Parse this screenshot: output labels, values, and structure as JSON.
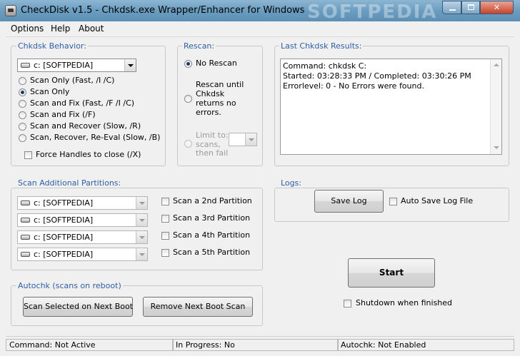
{
  "window": {
    "title": "CheckDisk   v1.5  -  Chkdsk.exe Wrapper/Enhancer for Windows",
    "watermark": "SOFTPEDIA"
  },
  "menu": [
    "Options",
    "Help",
    "About"
  ],
  "chkdsk_behavior": {
    "legend": "Chkdsk Behavior:",
    "drive": "c: [SOFTPEDIA]",
    "options": [
      {
        "label": "Scan Only (Fast, /I /C)",
        "selected": false
      },
      {
        "label": "Scan Only",
        "selected": true
      },
      {
        "label": "Scan and Fix (Fast, /F /I /C)",
        "selected": false
      },
      {
        "label": "Scan and Fix (/F)",
        "selected": false
      },
      {
        "label": "Scan and Recover (Slow, /R)",
        "selected": false
      },
      {
        "label": "Scan, Recover, Re-Eval (Slow, /B)",
        "selected": false
      }
    ],
    "force_handles": "Force Handles to close (/X)"
  },
  "rescan": {
    "legend": "Rescan:",
    "no_rescan": "No Rescan",
    "rescan_until": [
      "Rescan until",
      "Chkdsk",
      "returns no",
      "errors."
    ],
    "limit_to": [
      "Limit to:",
      "scans,",
      "then fail"
    ]
  },
  "results": {
    "legend": "Last Chkdsk Results:",
    "lines": [
      "Command:  chkdsk C:",
      "Started:  03:28:33 PM  /  Completed:  03:30:26 PM",
      "Errorlevel:  0 - No Errors were found."
    ]
  },
  "partitions": {
    "legend": "Scan Additional Partitions:",
    "rows": [
      {
        "drive": "c: [SOFTPEDIA]",
        "label": "Scan a 2nd Partition"
      },
      {
        "drive": "c: [SOFTPEDIA]",
        "label": "Scan a 3rd  Partition"
      },
      {
        "drive": "c: [SOFTPEDIA]",
        "label": "Scan a 4th  Partition"
      },
      {
        "drive": "c: [SOFTPEDIA]",
        "label": "Scan a 5th  Partition"
      }
    ]
  },
  "logs": {
    "legend": "Logs:",
    "save_log": "Save Log",
    "auto_save": "Auto Save Log File"
  },
  "autochk": {
    "legend": "Autochk (scans on reboot)",
    "scan_next_boot": "Scan Selected on Next Boot",
    "remove_next_boot": "Remove Next Boot Scan"
  },
  "start": "Start",
  "shutdown": "Shutdown when finished",
  "status": {
    "command": "Command:  Not Active",
    "progress": "In Progress:  No",
    "autochk": "Autochk:  Not Enabled"
  }
}
